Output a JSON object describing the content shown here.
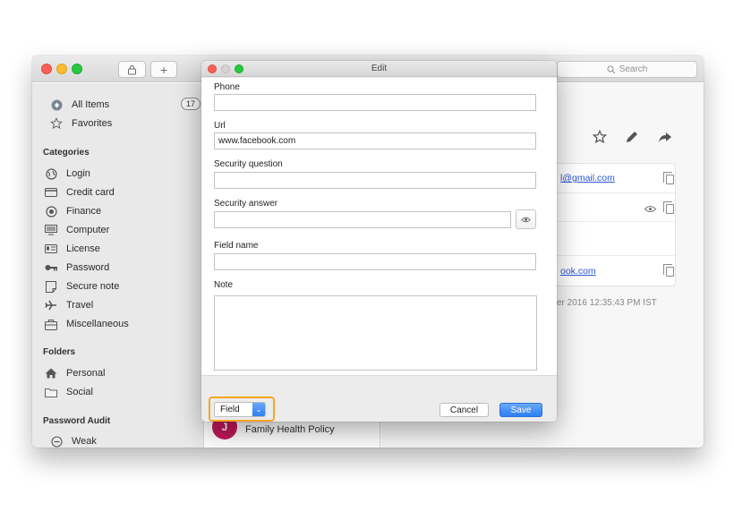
{
  "window": {
    "search_placeholder": "Search"
  },
  "sidebar": {
    "all_items": {
      "label": "All Items",
      "count": "17"
    },
    "favorites": {
      "label": "Favorites"
    },
    "categories_heading": "Categories",
    "categories": [
      {
        "label": "Login",
        "icon": "globe-icon"
      },
      {
        "label": "Credit card",
        "icon": "credit-card-icon"
      },
      {
        "label": "Finance",
        "icon": "finance-icon"
      },
      {
        "label": "Computer",
        "icon": "computer-icon"
      },
      {
        "label": "License",
        "icon": "license-icon"
      },
      {
        "label": "Password",
        "icon": "key-icon"
      },
      {
        "label": "Secure note",
        "icon": "note-icon"
      },
      {
        "label": "Travel",
        "icon": "plane-icon"
      },
      {
        "label": "Miscellaneous",
        "icon": "briefcase-icon"
      }
    ],
    "folders_heading": "Folders",
    "folders": [
      {
        "label": "Personal",
        "icon": "home-icon"
      },
      {
        "label": "Social",
        "icon": "folder-icon"
      }
    ],
    "audit_heading": "Password Audit",
    "audit": [
      {
        "label": "Weak",
        "icon": "minus-circle-icon"
      }
    ]
  },
  "list": {
    "visible_item": {
      "avatar_letter": "J",
      "title": "Family Health Policy"
    }
  },
  "detail": {
    "email_link": "l@gmail.com",
    "url_link": "ook.com",
    "timestamp": "er 2016 12:35:43 PM IST"
  },
  "dialog": {
    "title": "Edit",
    "fields": {
      "phone": {
        "label": "Phone",
        "value": ""
      },
      "url": {
        "label": "Url",
        "value": "www.facebook.com"
      },
      "security_question": {
        "label": "Security question",
        "value": ""
      },
      "security_answer": {
        "label": "Security answer",
        "value": ""
      },
      "field_name": {
        "label": "Field name",
        "value": ""
      },
      "note": {
        "label": "Note",
        "value": ""
      }
    },
    "field_type_select": "Field",
    "cancel_label": "Cancel",
    "save_label": "Save"
  },
  "colors": {
    "accent": "#2d7ef1",
    "highlight": "#f5a623",
    "link": "#2a57d6",
    "avatar": "#c2185b"
  }
}
